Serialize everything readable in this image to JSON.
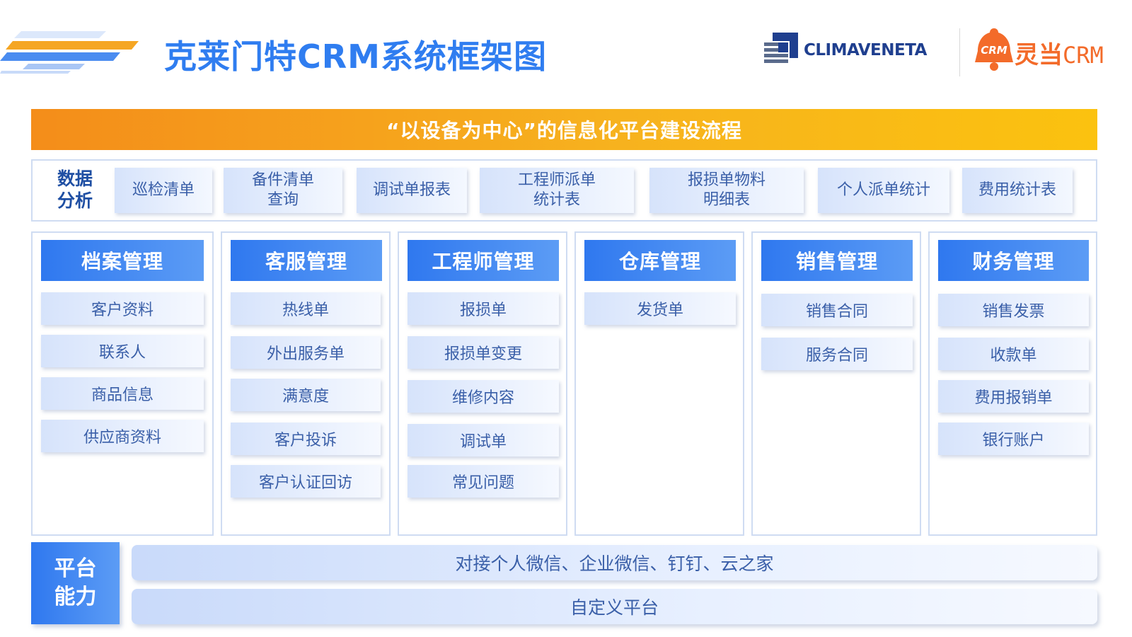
{
  "header": {
    "title": "克莱门特CRM系统框架图",
    "logo_climaveneta": "CLIMAVENETA",
    "logo_lingdang": "灵当",
    "logo_lingdang_crm": "CRM",
    "logo_bell_text": "CRM"
  },
  "banner": {
    "text": "“以设备为中心”的信息化平台建设流程"
  },
  "analysis": {
    "label": "数据\n分析",
    "items": [
      "巡检清单",
      "备件清单\n查询",
      "调试单报表",
      "工程师派单\n统计表",
      "报损单物料\n明细表",
      "个人派单统计",
      "费用统计表"
    ]
  },
  "modules": [
    {
      "title": "档案管理",
      "items": [
        "客户资料",
        "联系人",
        "商品信息",
        "供应商资料"
      ]
    },
    {
      "title": "客服管理",
      "items": [
        "热线单",
        "外出服务单",
        "满意度",
        "客户投诉",
        "客户认证回访"
      ]
    },
    {
      "title": "工程师管理",
      "items": [
        "报损单",
        "报损单变更",
        "维修内容",
        "调试单",
        "常见问题"
      ]
    },
    {
      "title": "仓库管理",
      "items": [
        "发货单"
      ]
    },
    {
      "title": "销售管理",
      "items": [
        "销售合同",
        "服务合同"
      ]
    },
    {
      "title": "财务管理",
      "items": [
        "销售发票",
        "收款单",
        "费用报销单",
        "银行账户"
      ]
    }
  ],
  "platform": {
    "label": "平台\n能力",
    "bars": [
      "对接个人微信、企业微信、钉钉、云之家",
      "自定义平台"
    ]
  },
  "colors": {
    "title_blue": "#2f7df0",
    "header_blue": "#2f78ef",
    "banner_orange": "#f48d1a",
    "banner_yellow": "#fbc20f",
    "logo_orange": "#f36b2a",
    "logo_navy": "#1f3f8f"
  }
}
